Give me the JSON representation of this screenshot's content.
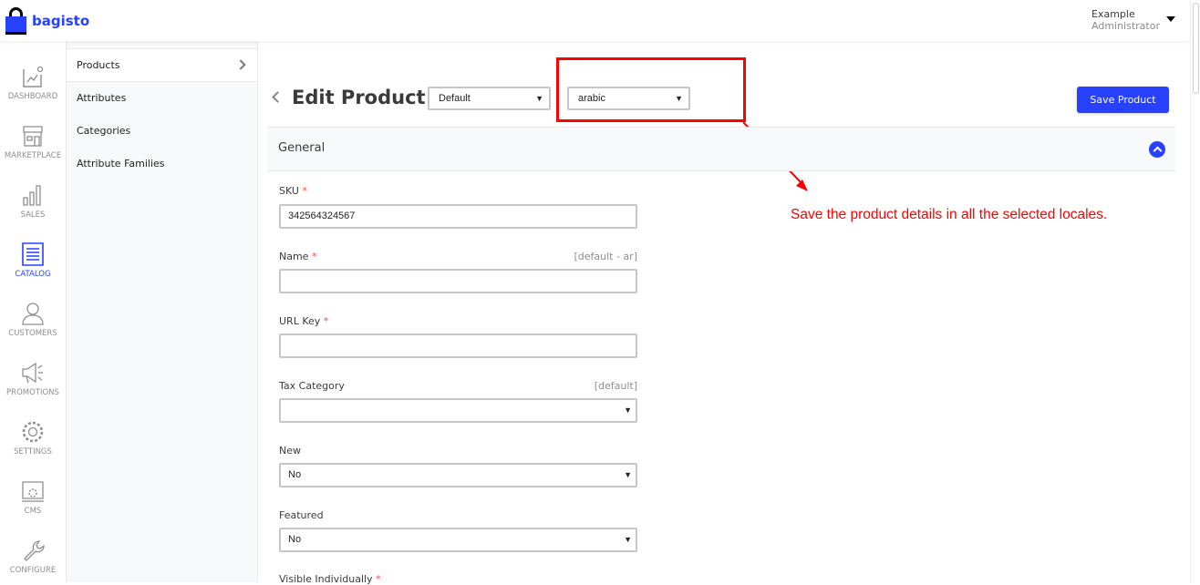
{
  "header": {
    "brand": "bagisto",
    "user_name": "Example",
    "user_role": "Administrator"
  },
  "nav": [
    {
      "label": "DASHBOARD",
      "icon": "dashboard-icon"
    },
    {
      "label": "MARKETPLACE",
      "icon": "marketplace-icon"
    },
    {
      "label": "SALES",
      "icon": "sales-icon"
    },
    {
      "label": "CATALOG",
      "icon": "catalog-icon",
      "active": true
    },
    {
      "label": "CUSTOMERS",
      "icon": "customers-icon"
    },
    {
      "label": "PROMOTIONS",
      "icon": "promotions-icon"
    },
    {
      "label": "SETTINGS",
      "icon": "settings-icon"
    },
    {
      "label": "CMS",
      "icon": "cms-icon"
    },
    {
      "label": "CONFIGURE",
      "icon": "configure-icon"
    }
  ],
  "submenu": [
    "Products",
    "Attributes",
    "Categories",
    "Attribute Families"
  ],
  "page": {
    "title": "Edit Product",
    "channel": "Default",
    "locale": "arabic",
    "save_label": "Save Product",
    "section": "General"
  },
  "fields": {
    "sku": {
      "label": "SKU",
      "value": "342564324567"
    },
    "name": {
      "label": "Name",
      "scope": "[default - ar]",
      "value": ""
    },
    "url_key": {
      "label": "URL Key",
      "value": ""
    },
    "tax_category": {
      "label": "Tax Category",
      "scope": "[default]",
      "value": ""
    },
    "new": {
      "label": "New",
      "value": "No"
    },
    "featured": {
      "label": "Featured",
      "value": "No"
    },
    "visible_individually": {
      "label": "Visible Individually"
    }
  },
  "annotation": {
    "text": "Save the product details in all the selected locales.",
    "color": "#ff0000"
  },
  "colors": {
    "accent": "#2741ff",
    "required": "#f05153"
  }
}
